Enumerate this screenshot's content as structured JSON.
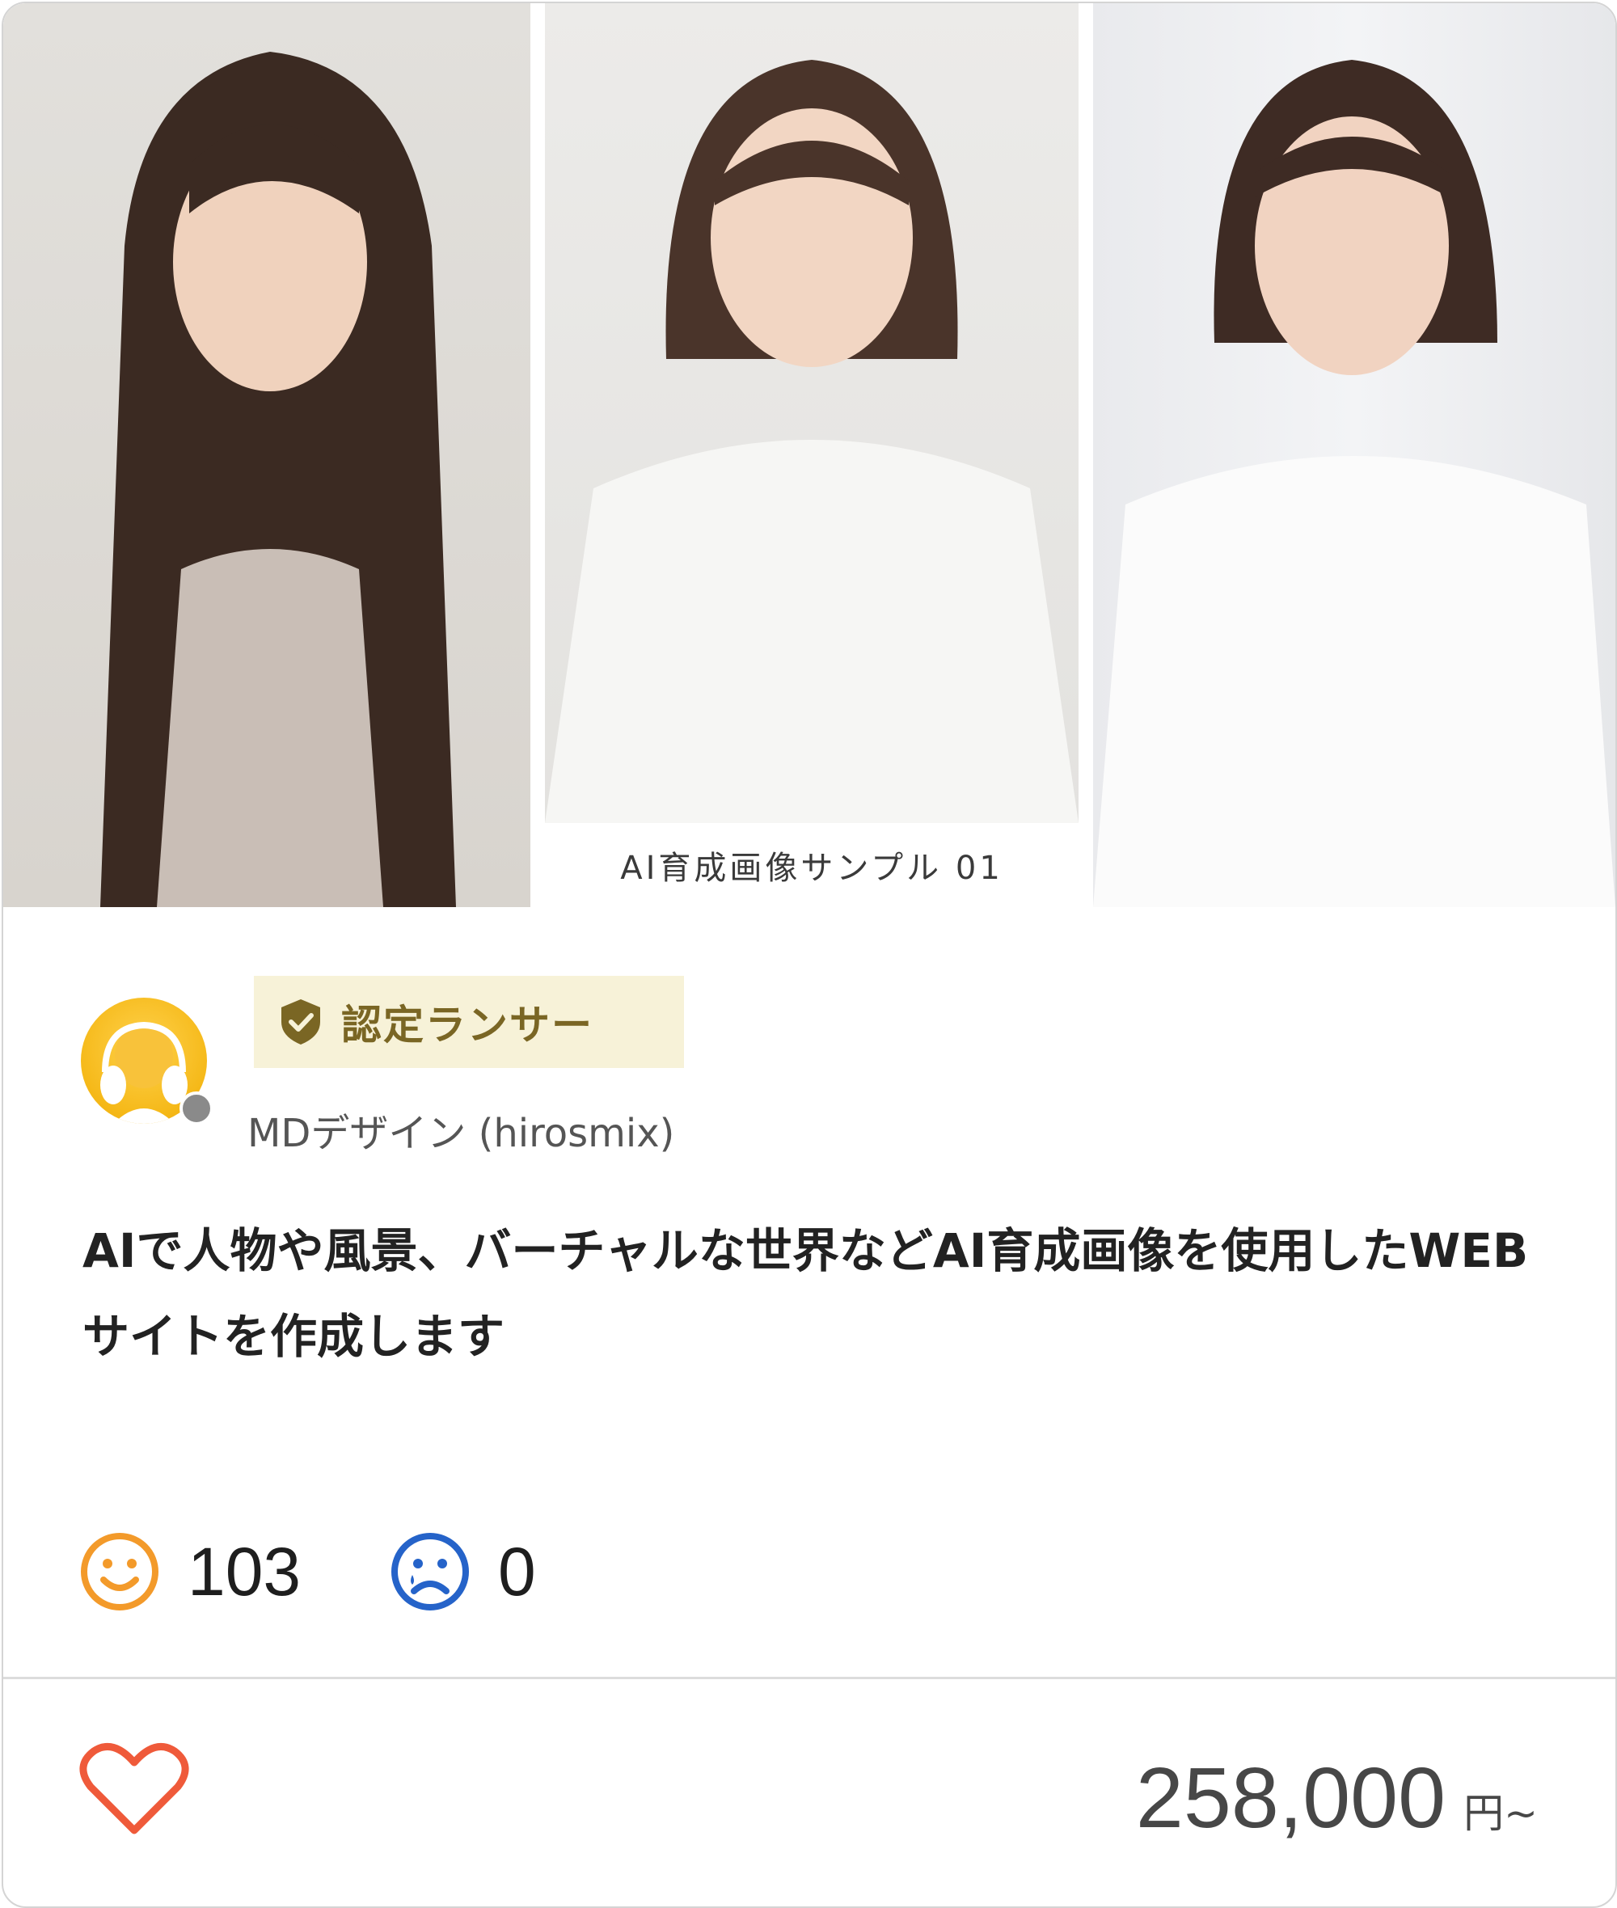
{
  "thumbnail": {
    "caption": "AI育成画像サンプル 01"
  },
  "badge": {
    "label": "認定ランサー",
    "icon": "shield-check-icon",
    "color": "#7a6624",
    "background": "#f7f2d8"
  },
  "seller": {
    "name": "MDデザイン (hirosmix)",
    "avatar_icon": "headphones-avatar-icon",
    "status_color": "#8a8a8a"
  },
  "service": {
    "title": "AIで人物や風景、バーチャルな世界などAI育成画像を使用したWEBサイトを作成します"
  },
  "ratings": {
    "good": {
      "icon": "smile-icon",
      "count": "103",
      "color": "#f39a2a"
    },
    "bad": {
      "icon": "sad-icon",
      "count": "0",
      "color": "#2563c9"
    }
  },
  "favorite": {
    "icon": "heart-outline-icon",
    "color": "#ef5a3a"
  },
  "price": {
    "value": "258,000",
    "unit": "円~"
  }
}
